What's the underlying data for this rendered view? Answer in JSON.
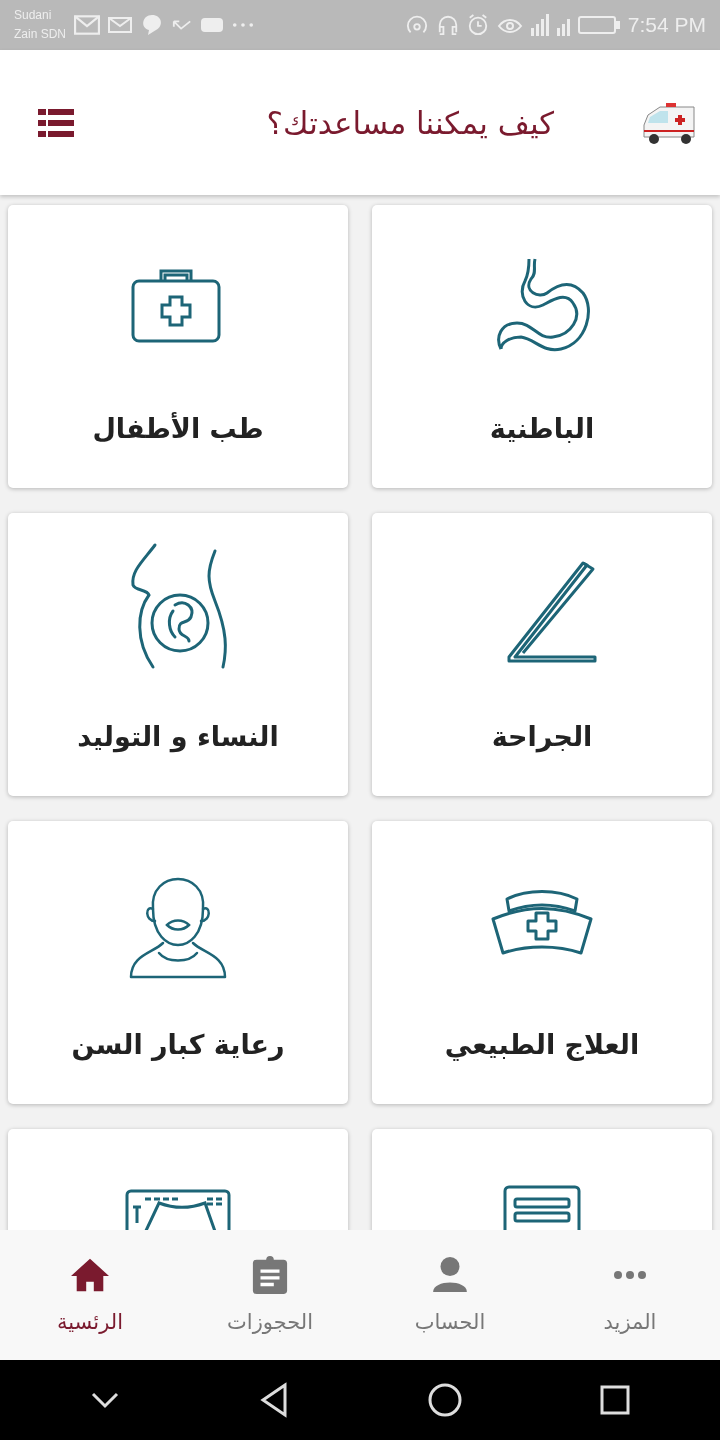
{
  "status_bar": {
    "carrier": [
      "Sudani",
      "Zain SDN"
    ],
    "time": "7:54 PM"
  },
  "header": {
    "title": "كيف يمكننا مساعدتك؟"
  },
  "cards": [
    {
      "kind": "stomach",
      "label": "الباطنية"
    },
    {
      "kind": "medical-kit",
      "label": "طب الأطفال"
    },
    {
      "kind": "scalpel",
      "label": "الجراحة"
    },
    {
      "kind": "pregnancy",
      "label": "النساء و التوليد"
    },
    {
      "kind": "nurse-cap",
      "label": "العلاج الطبيعي"
    },
    {
      "kind": "elderly",
      "label": "رعاية كبار السن"
    },
    {
      "kind": "document"
    },
    {
      "kind": "ultrasound"
    }
  ],
  "bottom_nav": [
    {
      "kind": "more",
      "label": "المزيد",
      "selected": false
    },
    {
      "kind": "person",
      "label": "الحساب",
      "selected": false
    },
    {
      "kind": "clipboard",
      "label": "الحجوزات",
      "selected": false
    },
    {
      "kind": "home",
      "label": "الرئسية",
      "selected": true
    }
  ]
}
